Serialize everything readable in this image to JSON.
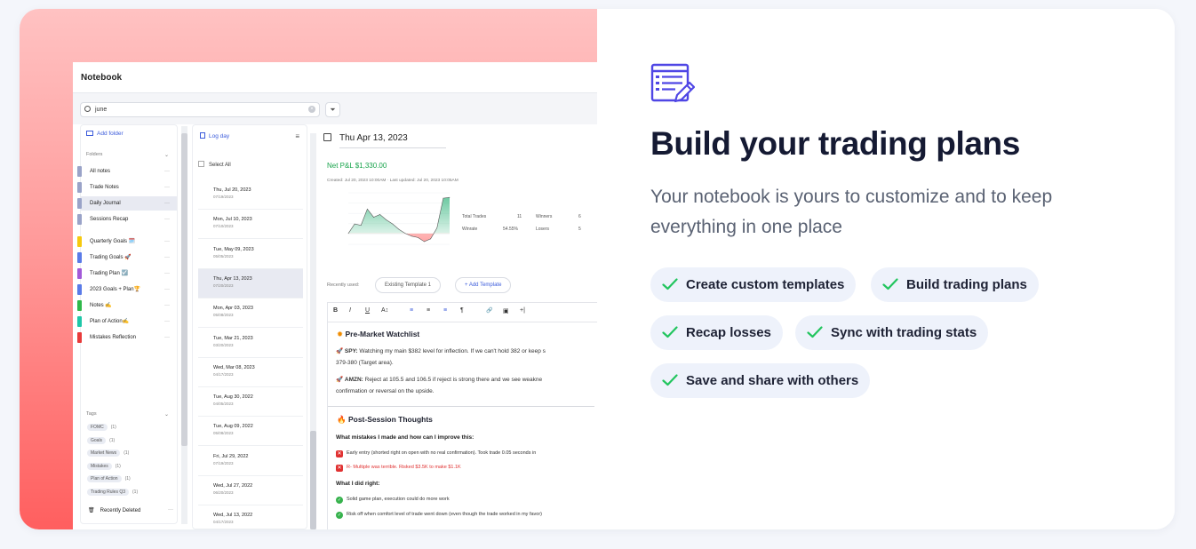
{
  "app": {
    "title": "Notebook",
    "search_value": "june",
    "add_folder": "Add folder",
    "folders_header": "Folders",
    "folders": [
      {
        "label": "All notes",
        "color": "#9aa3c8"
      },
      {
        "label": "Trade Notes",
        "color": "#9aa3c8"
      },
      {
        "label": "Daily Journal",
        "color": "#9aa3c8"
      },
      {
        "label": "Sessions Recap",
        "color": "#9aa3c8"
      },
      {
        "label": "Quarterly Goals 🗓️",
        "color": "#f6c90e"
      },
      {
        "label": "Trading Goals 🚀",
        "color": "#5a7be8"
      },
      {
        "label": "Trading Plan ☑️",
        "color": "#a35ad8"
      },
      {
        "label": "2023 Goals + Plan🏆",
        "color": "#5a7be8"
      },
      {
        "label": "Notes ✍️",
        "color": "#2fb84a"
      },
      {
        "label": "Plan of Action✍️",
        "color": "#1fc7a8"
      },
      {
        "label": "Mistakes Reflection",
        "color": "#e83a3a"
      }
    ],
    "tags_header": "Tags",
    "tags": [
      {
        "label": "FOMC",
        "count": "(1)"
      },
      {
        "label": "Goals",
        "count": "(1)"
      },
      {
        "label": "Market News",
        "count": "(1)"
      },
      {
        "label": "Mistakes",
        "count": "(1)"
      },
      {
        "label": "Plan of Action",
        "count": "(1)"
      },
      {
        "label": "Trading Rules Q3",
        "count": "(1)"
      }
    ],
    "recently_deleted": "Recently Deleted",
    "dots": "···",
    "log_day": "Log day",
    "select_all": "Select All",
    "entries": [
      {
        "date": "Thu, Jul 20, 2023",
        "sub": "07/19/2023"
      },
      {
        "date": "Mon, Jul 10, 2023",
        "sub": "07/10/2023"
      },
      {
        "date": "Tue, May 09, 2023",
        "sub": "05/05/2023"
      },
      {
        "date": "Thu, Apr 13, 2023",
        "sub": "07/20/2023"
      },
      {
        "date": "Mon, Apr 03, 2023",
        "sub": "05/08/2023"
      },
      {
        "date": "Tue, Mar 21, 2023",
        "sub": "03/20/2023"
      },
      {
        "date": "Wed, Mar 08, 2023",
        "sub": "04/17/2023"
      },
      {
        "date": "Tue, Aug 30, 2022",
        "sub": "04/05/2023"
      },
      {
        "date": "Tue, Aug 09, 2022",
        "sub": "05/08/2023"
      },
      {
        "date": "Fri, Jul 29, 2022",
        "sub": "07/19/2023"
      },
      {
        "date": "Wed, Jul 27, 2022",
        "sub": "06/20/2023"
      },
      {
        "date": "Wed, Jul 13, 2022",
        "sub": "04/17/2023"
      }
    ],
    "editor": {
      "date": "Thu Apr 13, 2023",
      "net_pnl": "Net P&L $1,330.00",
      "meta": "Created: Jul 20, 2023 10:00AM · Last updated: Jul 20, 2023 10:05AM",
      "stats": {
        "total_trades_label": "Total Trades",
        "total_trades": "11",
        "winners_label": "Winners",
        "winners": "6",
        "winrate_label": "Winrate",
        "winrate": "54.55%",
        "losers_label": "Losers",
        "losers": "5"
      },
      "recently_used": "Recently used:",
      "template_pill": "Existing Template 1",
      "add_template": "+ Add Template",
      "toolbar": [
        "B",
        "I",
        "U",
        "A↕",
        "≡",
        "≡",
        "≡",
        "¶",
        "🔗",
        "▣",
        "+|"
      ],
      "h1": "Pre-Market Watchlist",
      "spy_label": "SPY:",
      "spy_text": "Watching my main $382 level for inflection. If we can't hold 382 or keep s",
      "spy_text2": "379-380 (Target area).",
      "amzn_label": "AMZN:",
      "amzn_text": "Reject at 105.5 and 106.5 if reject is strong there and we see weakne",
      "amzn_text2": "confirmation or reversal on the upside.",
      "h2": "Post-Session Thoughts",
      "q1": "What mistakes I made and how can I improve this:",
      "bad1": "Early entry (shorted right on open with no real confirmation). Took trade 0.05 seconds in",
      "bad2": "R- Multiple was terrible. Risked $3.5K to make $1.1K",
      "q2": "What I did right:",
      "good1": "Solid game plan, execution could do more work",
      "good2": "Risk off when comfort level of trade went down (even though the trade worked in my favor)"
    }
  },
  "chart_data": {
    "type": "area",
    "values": [
      0,
      350,
      300,
      900,
      600,
      700,
      500,
      350,
      150,
      0,
      -100,
      -150,
      -300,
      -200,
      200,
      1300,
      1330
    ],
    "title": "",
    "ylim": [
      -400,
      1500
    ]
  },
  "hero": {
    "title": "Build your trading plans",
    "subtitle": "Your notebook is yours to customize and to keep everything in one place",
    "features": [
      "Create custom templates",
      "Build trading plans",
      "Recap losses",
      "Sync with trading stats",
      "Save and share with others"
    ],
    "accent": "#4f46e5",
    "check_color": "#22c55e"
  }
}
